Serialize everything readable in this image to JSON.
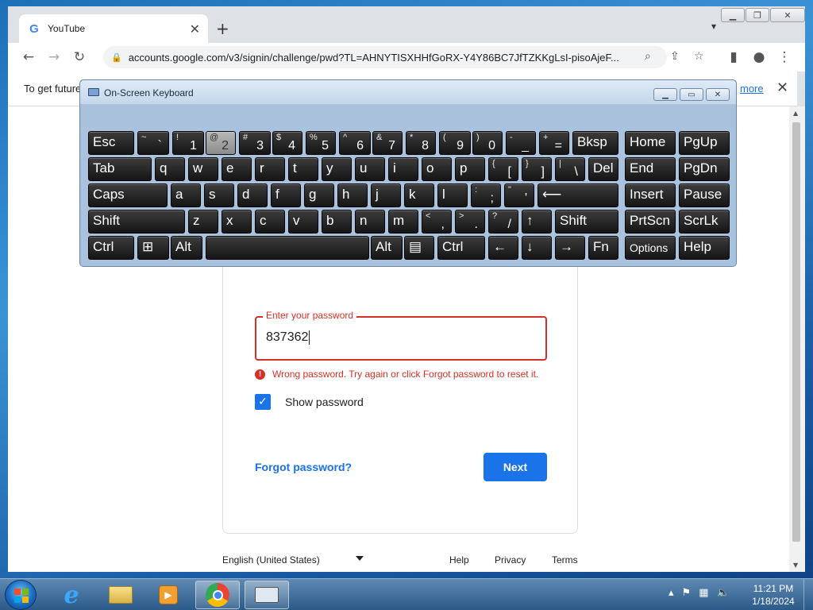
{
  "browser": {
    "tab_title": "YouTube",
    "url": "accounts.google.com/v3/signin/challenge/pwd?TL=AHNYTISXHHfGoRX-Y4Y86BC7JfTZKKgLsI-pisoAjeF...",
    "infobar_text": "To get future",
    "infobar_link": "more"
  },
  "signin": {
    "password_label": "Enter your password",
    "password_value": "837362",
    "error_text": "Wrong password. Try again or click Forgot password to reset it.",
    "show_password_label": "Show password",
    "forgot_label": "Forgot password?",
    "next_label": "Next"
  },
  "footer": {
    "language": "English (United States)",
    "help": "Help",
    "privacy": "Privacy",
    "terms": "Terms"
  },
  "osk": {
    "title": "On-Screen Keyboard",
    "pressed_key": "2",
    "keys": [
      {
        "name": "esc",
        "main": "Esc"
      },
      {
        "name": "backtick",
        "sh": "~",
        "ch": "`"
      },
      {
        "name": "1",
        "sh": "!",
        "ch": "1"
      },
      {
        "name": "2",
        "sh": "@",
        "ch": "2"
      },
      {
        "name": "3",
        "sh": "#",
        "ch": "3"
      },
      {
        "name": "4",
        "sh": "$",
        "ch": "4"
      },
      {
        "name": "5",
        "sh": "%",
        "ch": "5"
      },
      {
        "name": "6",
        "sh": "^",
        "ch": "6"
      },
      {
        "name": "7",
        "sh": "&",
        "ch": "7"
      },
      {
        "name": "8",
        "sh": "*",
        "ch": "8"
      },
      {
        "name": "9",
        "sh": "(",
        "ch": "9"
      },
      {
        "name": "0",
        "sh": ")",
        "ch": "0"
      },
      {
        "name": "minus",
        "sh": "-",
        "ch": "_"
      },
      {
        "name": "equals",
        "sh": "+",
        "ch": "="
      },
      {
        "name": "bksp",
        "main": "Bksp"
      },
      {
        "name": "home",
        "main": "Home"
      },
      {
        "name": "pgup",
        "main": "PgUp"
      },
      {
        "name": "tab",
        "main": "Tab"
      },
      {
        "name": "q",
        "main": "q"
      },
      {
        "name": "w",
        "main": "w"
      },
      {
        "name": "e",
        "main": "e"
      },
      {
        "name": "r",
        "main": "r"
      },
      {
        "name": "t",
        "main": "t"
      },
      {
        "name": "y",
        "main": "y"
      },
      {
        "name": "u",
        "main": "u"
      },
      {
        "name": "i",
        "main": "i"
      },
      {
        "name": "o",
        "main": "o"
      },
      {
        "name": "p",
        "main": "p"
      },
      {
        "name": "lbracket",
        "sh": "{",
        "ch": "["
      },
      {
        "name": "rbracket",
        "sh": "}",
        "ch": "]"
      },
      {
        "name": "backslash",
        "sh": "|",
        "ch": "\\"
      },
      {
        "name": "del",
        "main": "Del"
      },
      {
        "name": "end",
        "main": "End"
      },
      {
        "name": "pgdn",
        "main": "PgDn"
      },
      {
        "name": "caps",
        "main": "Caps"
      },
      {
        "name": "a",
        "main": "a"
      },
      {
        "name": "s",
        "main": "s"
      },
      {
        "name": "d",
        "main": "d"
      },
      {
        "name": "f",
        "main": "f"
      },
      {
        "name": "g",
        "main": "g"
      },
      {
        "name": "h",
        "main": "h"
      },
      {
        "name": "j",
        "main": "j"
      },
      {
        "name": "k",
        "main": "k"
      },
      {
        "name": "l",
        "main": "l"
      },
      {
        "name": "semicolon",
        "sh": ":",
        "ch": ";"
      },
      {
        "name": "quote",
        "sh": "\"",
        "ch": "'"
      },
      {
        "name": "enter",
        "main": "⟵"
      },
      {
        "name": "insert",
        "main": "Insert"
      },
      {
        "name": "pause",
        "main": "Pause"
      },
      {
        "name": "lshift",
        "main": "Shift"
      },
      {
        "name": "z",
        "main": "z"
      },
      {
        "name": "x",
        "main": "x"
      },
      {
        "name": "c",
        "main": "c"
      },
      {
        "name": "v",
        "main": "v"
      },
      {
        "name": "b",
        "main": "b"
      },
      {
        "name": "n",
        "main": "n"
      },
      {
        "name": "m",
        "main": "m"
      },
      {
        "name": "comma",
        "sh": "<",
        "ch": ","
      },
      {
        "name": "period",
        "sh": ">",
        "ch": "."
      },
      {
        "name": "slash",
        "sh": "?",
        "ch": "/"
      },
      {
        "name": "up",
        "main": "↑"
      },
      {
        "name": "rshift",
        "main": "Shift"
      },
      {
        "name": "prtscn",
        "main": "PrtScn"
      },
      {
        "name": "scrlk",
        "main": "ScrLk"
      },
      {
        "name": "lctrl",
        "main": "Ctrl"
      },
      {
        "name": "win",
        "main": "⊞"
      },
      {
        "name": "lalt",
        "main": "Alt"
      },
      {
        "name": "space",
        "main": ""
      },
      {
        "name": "ralt",
        "main": "Alt"
      },
      {
        "name": "menu",
        "main": "▤"
      },
      {
        "name": "rctrl",
        "main": "Ctrl"
      },
      {
        "name": "left",
        "main": "←"
      },
      {
        "name": "down",
        "main": "↓"
      },
      {
        "name": "right",
        "main": "→"
      },
      {
        "name": "fn",
        "main": "Fn"
      },
      {
        "name": "options",
        "main": "Options"
      },
      {
        "name": "help",
        "main": "Help"
      }
    ]
  },
  "taskbar": {
    "time": "11:21 PM",
    "date": "1/18/2024"
  }
}
